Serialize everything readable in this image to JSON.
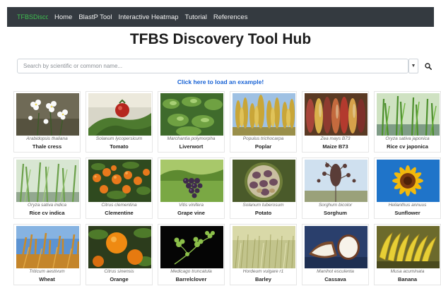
{
  "nav": {
    "brand": "TFBSDiscovery",
    "links": [
      "Home",
      "BlastP Tool",
      "Interactive Heatmap",
      "Tutorial",
      "References"
    ]
  },
  "title": "TFBS Discovery Tool Hub",
  "search": {
    "placeholder": "Search by scientific or common name..."
  },
  "example_link": "Click here to load an example!",
  "species": [
    {
      "sci": "Arabidopsis thaliana",
      "common": "Thale cress"
    },
    {
      "sci": "Solanum lycopersicum",
      "common": "Tomato"
    },
    {
      "sci": "Marchantia polymorpha",
      "common": "Liverwort"
    },
    {
      "sci": "Populus trichocarpa",
      "common": "Poplar"
    },
    {
      "sci": "Zea mays B73",
      "common": "Maize B73"
    },
    {
      "sci": "Oryza sativa japonica",
      "common": "Rice cv japonica"
    },
    {
      "sci": "Oryza sativa indica",
      "common": "Rice cv indica"
    },
    {
      "sci": "Citrus clementina",
      "common": "Clementine"
    },
    {
      "sci": "Vitis vinifera",
      "common": "Grape vine"
    },
    {
      "sci": "Solanum tuberosum",
      "common": "Potato"
    },
    {
      "sci": "Sorghum bicolor",
      "common": "Sorghum"
    },
    {
      "sci": "Helianthus annuus",
      "common": "Sunflower"
    },
    {
      "sci": "Triticum aestivum",
      "common": "Wheat"
    },
    {
      "sci": "Citrus sinensis",
      "common": "Orange"
    },
    {
      "sci": "Medicago truncatula",
      "common": "Barrelclover"
    },
    {
      "sci": "Hordeum vulgare r1",
      "common": "Barley"
    },
    {
      "sci": "Manihot esculenta",
      "common": "Cassava"
    },
    {
      "sci": "Musa acuminata",
      "common": "Banana"
    }
  ],
  "colors": {
    "navbar": "#343a40",
    "brand": "#3fbf4f",
    "link": "#1560d4"
  }
}
